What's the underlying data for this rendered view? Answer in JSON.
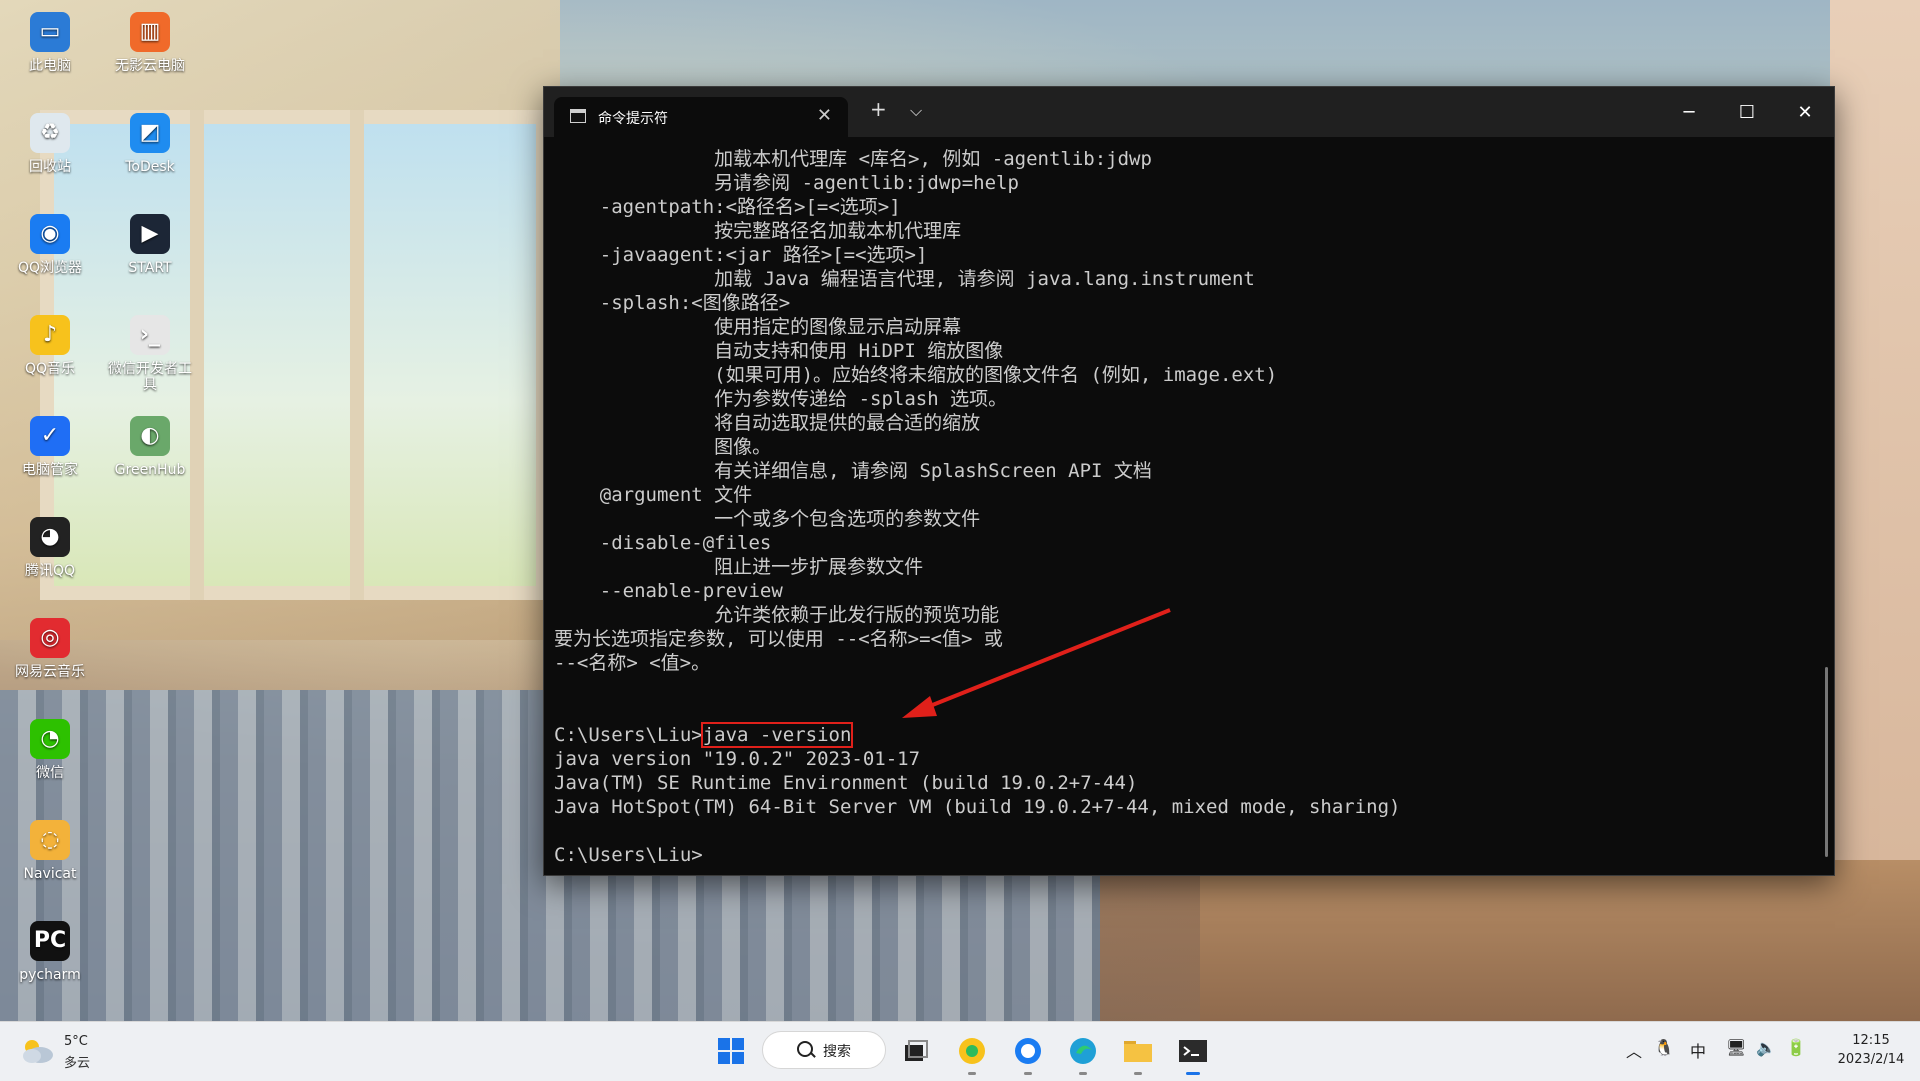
{
  "desktop": {
    "icons": [
      {
        "label": "此电脑",
        "icon": "computer-icon",
        "color": "#2b7bd6"
      },
      {
        "label": "无影云电脑",
        "icon": "cloud-pc-icon",
        "color": "#f06a2a"
      },
      {
        "label": "回收站",
        "icon": "recycle-bin-icon",
        "color": "#dfe8ee"
      },
      {
        "label": "ToDesk",
        "icon": "todesk-icon",
        "color": "#1f8cf0"
      },
      {
        "label": "QQ浏览器",
        "icon": "qq-browser-icon",
        "color": "#1a7cf2"
      },
      {
        "label": "START",
        "icon": "start-icon",
        "color": "#1c2636"
      },
      {
        "label": "QQ音乐",
        "icon": "qq-music-icon",
        "color": "#f7c21c"
      },
      {
        "label": "微信开发者工具",
        "icon": "wechat-devtools-icon",
        "color": "#e6e6e6"
      },
      {
        "label": "电脑管家",
        "icon": "pc-manager-icon",
        "color": "#1f6ef5"
      },
      {
        "label": "GreenHub",
        "icon": "greenhub-icon",
        "color": "#6aa86a"
      },
      {
        "label": "腾讯QQ",
        "icon": "qq-icon",
        "color": "#222222"
      },
      {
        "label": "网易云音乐",
        "icon": "netease-music-icon",
        "color": "#e22b30"
      },
      {
        "label": "微信",
        "icon": "wechat-icon",
        "color": "#2dc100"
      },
      {
        "label": "Navicat",
        "icon": "navicat-icon",
        "color": "#f3b23a"
      },
      {
        "label": "pycharm",
        "icon": "pycharm-icon",
        "color": "#111111"
      }
    ]
  },
  "terminal": {
    "tab_title": "命令提示符",
    "lines": [
      "              加载本机代理库 <库名>, 例如 -agentlib:jdwp",
      "              另请参阅 -agentlib:jdwp=help",
      "    -agentpath:<路径名>[=<选项>]",
      "              按完整路径名加载本机代理库",
      "    -javaagent:<jar 路径>[=<选项>]",
      "              加载 Java 编程语言代理, 请参阅 java.lang.instrument",
      "    -splash:<图像路径>",
      "              使用指定的图像显示启动屏幕",
      "              自动支持和使用 HiDPI 缩放图像",
      "              (如果可用)。应始终将未缩放的图像文件名 (例如, image.ext)",
      "              作为参数传递给 -splash 选项。",
      "              将自动选取提供的最合适的缩放",
      "              图像。",
      "              有关详细信息, 请参阅 SplashScreen API 文档",
      "    @argument 文件",
      "              一个或多个包含选项的参数文件",
      "    -disable-@files",
      "              阻止进一步扩展参数文件",
      "    --enable-preview",
      "              允许类依赖于此发行版的预览功能",
      "要为长选项指定参数, 可以使用 --<名称>=<值> 或",
      "--<名称> <值>。",
      "",
      ""
    ],
    "prompt": "C:\\Users\\Liu>",
    "command": "java -version",
    "output": [
      "java version \"19.0.2\" 2023-01-17",
      "Java(TM) SE Runtime Environment (build 19.0.2+7-44)",
      "Java HotSpot(TM) 64-Bit Server VM (build 19.0.2+7-44, mixed mode, sharing)",
      ""
    ],
    "final_prompt": "C:\\Users\\Liu>",
    "highlight_color": "#e0201a"
  },
  "taskbar": {
    "weather_temp": "5°C",
    "weather_desc": "多云",
    "search_label": "搜索",
    "ime_label": "中",
    "time": "12:15",
    "date": "2023/2/14"
  }
}
